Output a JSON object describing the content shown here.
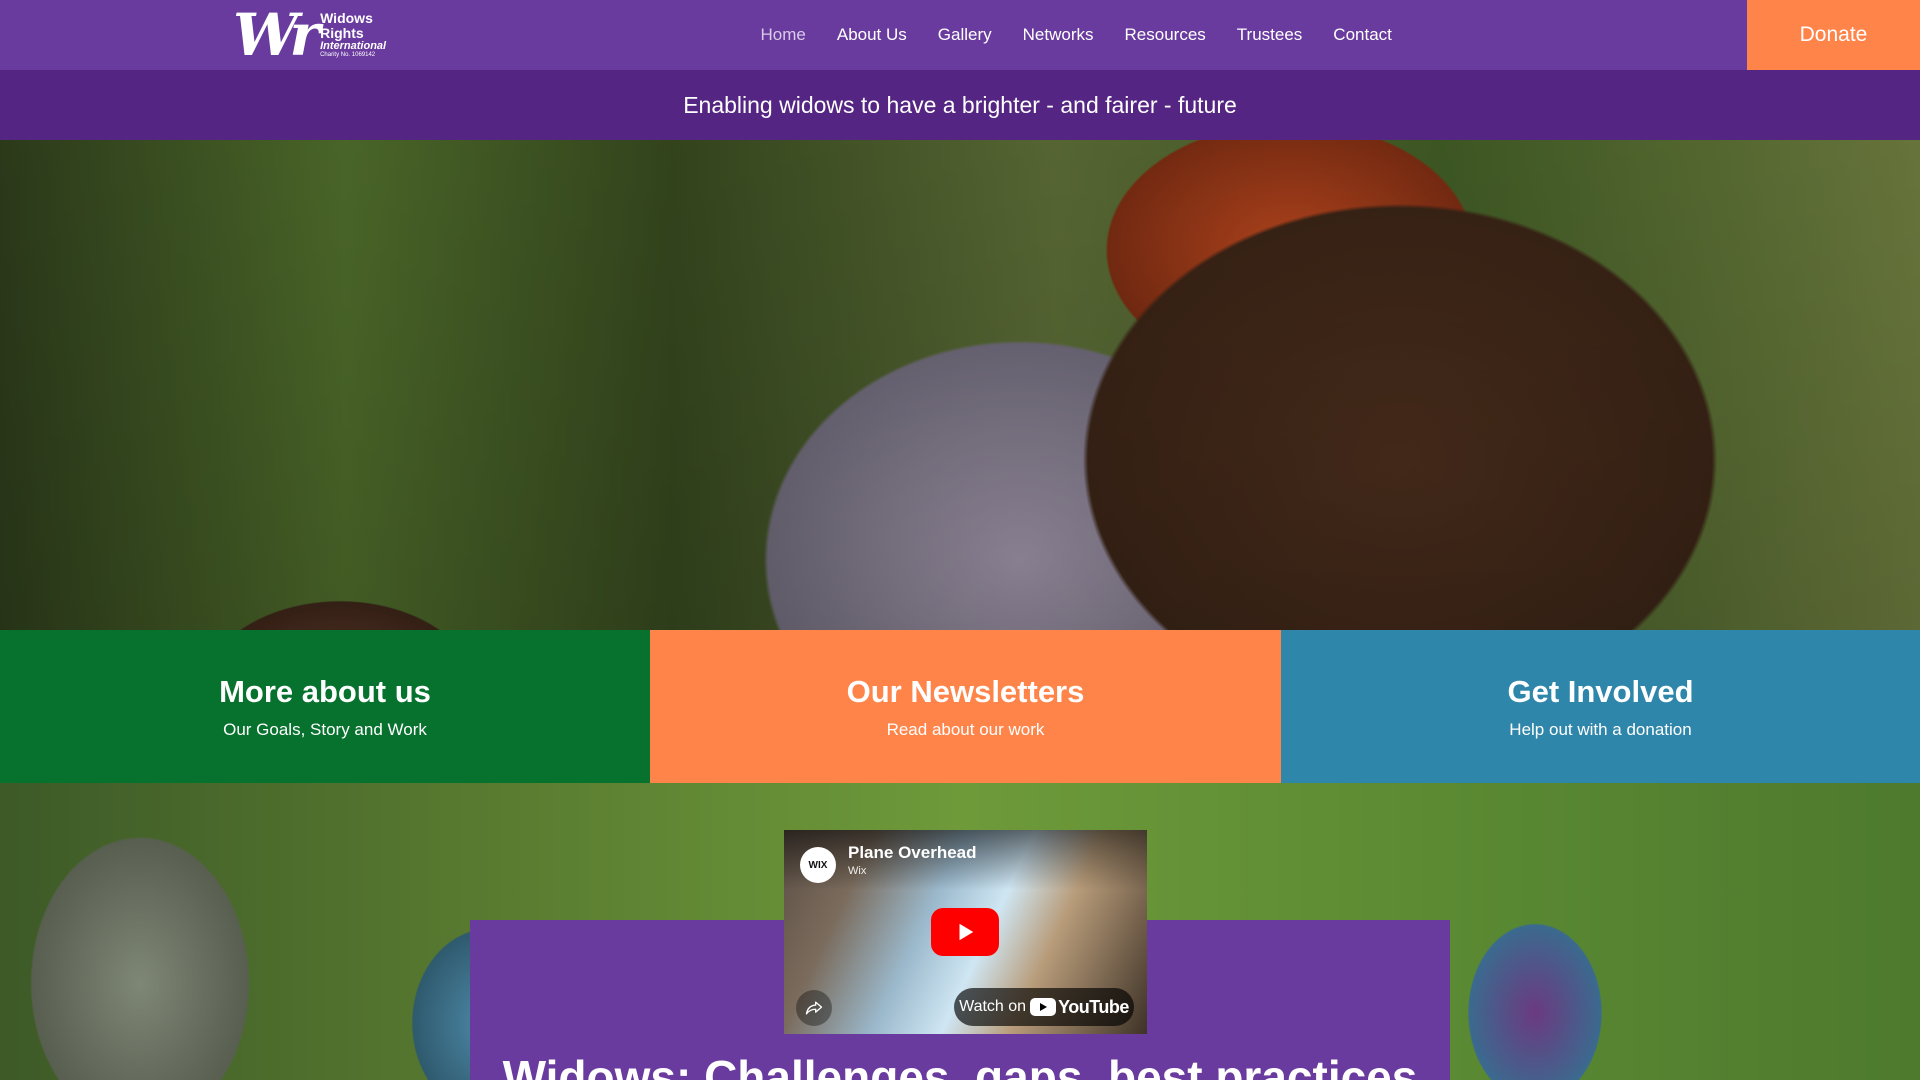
{
  "header": {
    "logo": {
      "mark": "Wr",
      "line1": "Widows",
      "line2": "Rights",
      "line3": "International",
      "line4": "Charity No. 1069142"
    },
    "nav": [
      "Home",
      "About Us",
      "Gallery",
      "Networks",
      "Resources",
      "Trustees",
      "Contact"
    ],
    "active_nav": "Home",
    "donate_label": "Donate"
  },
  "tagline": "Enabling widows to have a brighter - and fairer - future",
  "cards": [
    {
      "title": "More about us",
      "subtitle": "Our Goals, Story and Work",
      "color": "#06722e"
    },
    {
      "title": "Our Newsletters",
      "subtitle": "Read about our work",
      "color": "#ff844a"
    },
    {
      "title": "Get Involved",
      "subtitle": "Help out with a donation",
      "color": "#2f86ab"
    }
  ],
  "video": {
    "badge": "WIX",
    "title": "Plane Overhead",
    "channel": "Wix",
    "watch_on_label": "Watch on",
    "platform": "YouTube",
    "play_icon": "play-icon",
    "share_icon": "share-icon"
  },
  "section_heading": "Widows: Challenges, gaps, best practices",
  "colors": {
    "brand_purple": "#6a3b9e",
    "tagline_purple": "#552583",
    "donate_orange": "#ff844a",
    "card_green": "#06722e",
    "card_blue": "#2f86ab",
    "youtube_red": "#ff0000"
  }
}
